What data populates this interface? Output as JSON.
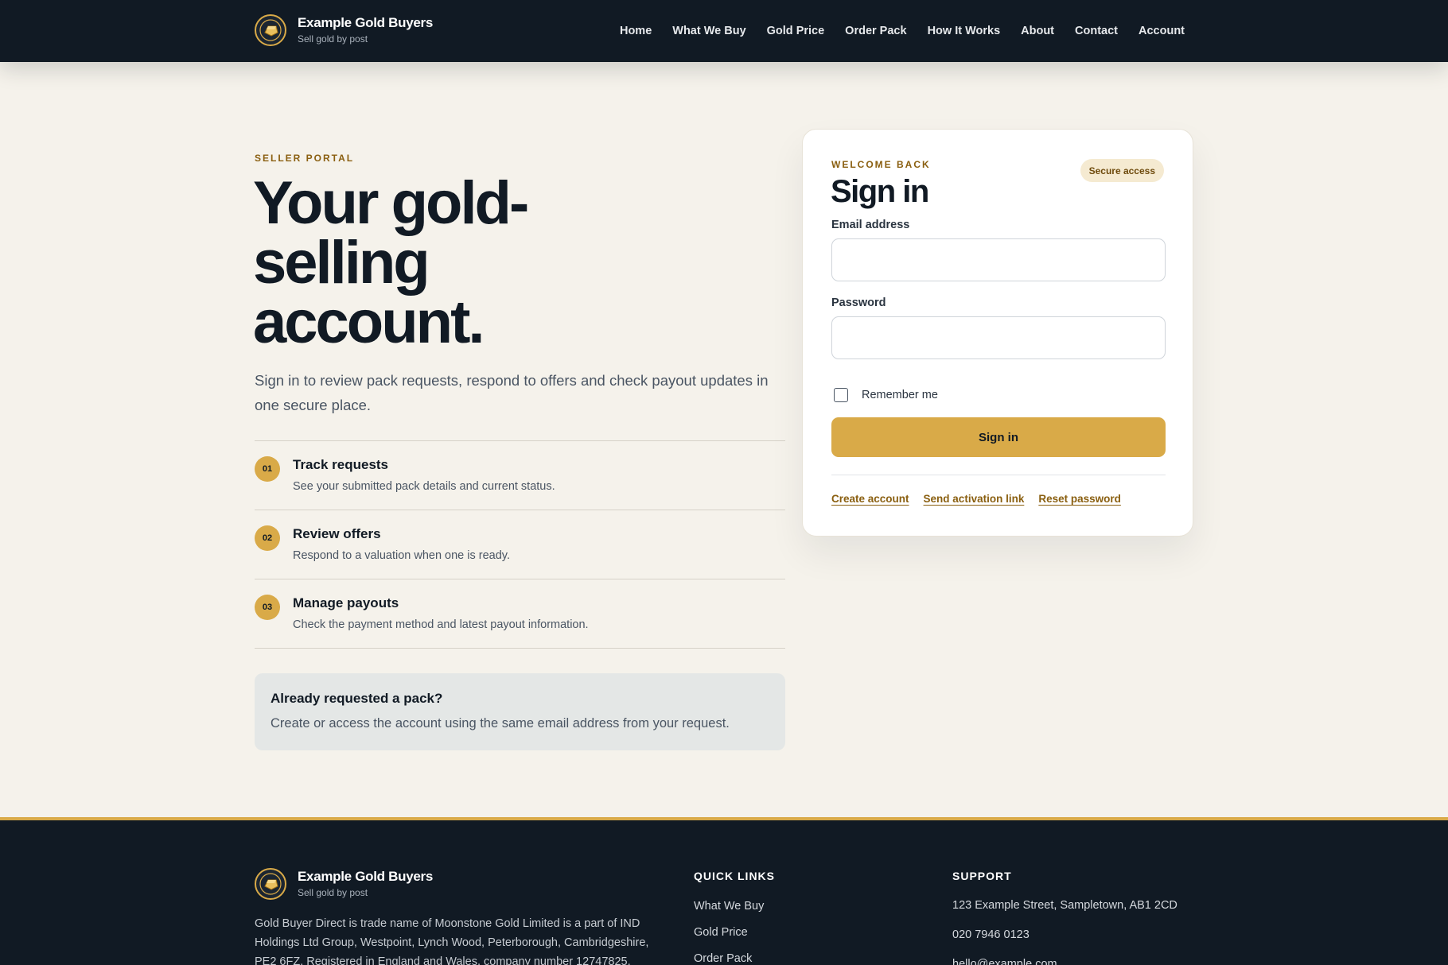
{
  "brand": {
    "name": "Example Gold Buyers",
    "tagline": "Sell gold by post"
  },
  "nav": {
    "items": [
      "Home",
      "What We Buy",
      "Gold Price",
      "Order Pack",
      "How It Works",
      "About",
      "Contact",
      "Account"
    ]
  },
  "hero": {
    "eyebrow": "SELLER PORTAL",
    "title": "Your gold-selling account.",
    "lead": "Sign in to review pack requests, respond to offers and check payout updates in one secure place."
  },
  "features": [
    {
      "num": "01",
      "title": "Track requests",
      "desc": "See your submitted pack details and current status."
    },
    {
      "num": "02",
      "title": "Review offers",
      "desc": "Respond to a valuation when one is ready."
    },
    {
      "num": "03",
      "title": "Manage payouts",
      "desc": "Check the payment method and latest payout information."
    }
  ],
  "callout": {
    "title": "Already requested a pack?",
    "text": "Create or access the account using the same email address from your request."
  },
  "signin": {
    "eyebrow": "WELCOME BACK",
    "title": "Sign in",
    "badge": "Secure access",
    "email_label": "Email address",
    "email_value": "",
    "password_label": "Password",
    "password_value": "",
    "remember_label": "Remember me",
    "remember_checked": false,
    "submit_label": "Sign in",
    "links": [
      "Create account",
      "Send activation link",
      "Reset password"
    ]
  },
  "footer": {
    "about": "Gold Buyer Direct is trade name of Moonstone Gold Limited is a part of IND Holdings Ltd Group, Westpoint, Lynch Wood, Peterborough, Cambridgeshire, PE2 6FZ. Registered in England and Wales, company number 12747825.",
    "quick_links_heading": "QUICK LINKS",
    "quick_links": [
      "What We Buy",
      "Gold Price",
      "Order Pack"
    ],
    "support_heading": "SUPPORT",
    "support": [
      "123 Example Street, Sampletown, AB1 2CD",
      "020 7946 0123",
      "hello@example.com"
    ]
  },
  "colors": {
    "navy": "#111a24",
    "gold": "#d9aa48",
    "gold_text": "#8a5f10",
    "page_bg": "#f5f2eb"
  },
  "icons": {
    "logo": "gold-bar-logo-icon"
  }
}
